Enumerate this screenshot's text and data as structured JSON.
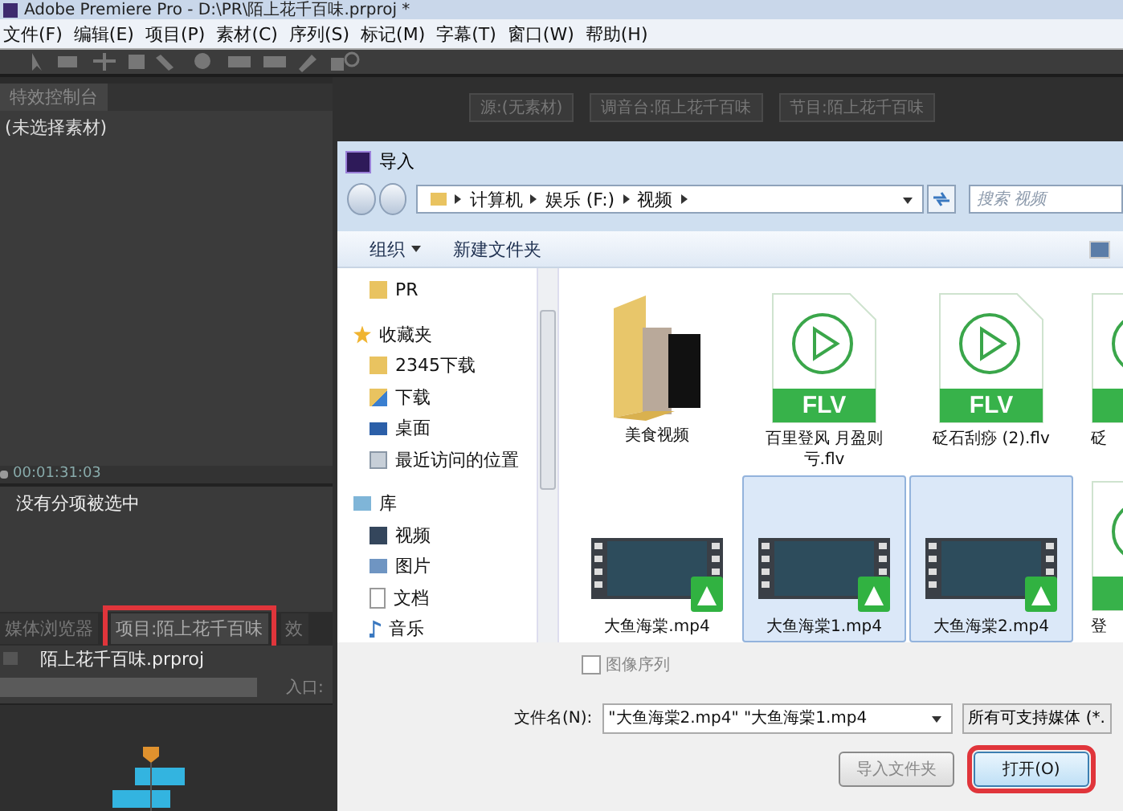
{
  "app": {
    "title": "Adobe Premiere Pro - D:\\PR\\陌上花千百味.prproj *",
    "menu": [
      "文件(F)",
      "编辑(E)",
      "项目(P)",
      "素材(C)",
      "序列(S)",
      "标记(M)",
      "字幕(T)",
      "窗口(W)",
      "帮助(H)"
    ]
  },
  "effects_panel": {
    "tab": "特效控制台",
    "message": "(未选择素材)",
    "timecode": "00:01:31:03"
  },
  "info_panel": {
    "message": "没有分项被选中"
  },
  "monitor_tabs": [
    {
      "label": "源:(无素材)"
    },
    {
      "label": "调音台:陌上花千百味"
    },
    {
      "label": "节目:陌上花千百味"
    }
  ],
  "project_tabs": [
    {
      "label": "媒体浏览器",
      "selected": false,
      "highlighted": false
    },
    {
      "label": "项目:陌上花千百味",
      "selected": true,
      "highlighted": true
    },
    {
      "label": "效",
      "selected": false,
      "highlighted": false
    }
  ],
  "project": {
    "file": "陌上花千百味.prproj",
    "in_label": "入口:"
  },
  "dialog": {
    "title": "导入",
    "breadcrumbs": [
      "计算机",
      "娱乐 (F:)",
      "视频"
    ],
    "search_placeholder": "搜索 视频",
    "toolbar": {
      "organize": "组织",
      "new_folder": "新建文件夹"
    },
    "nav": [
      {
        "label": "PR",
        "kind": "folder"
      },
      {
        "label": "收藏夹",
        "kind": "star",
        "children": [
          {
            "label": "2345下载",
            "kind": "folder"
          },
          {
            "label": "下载",
            "kind": "download"
          },
          {
            "label": "桌面",
            "kind": "desktop"
          },
          {
            "label": "最近访问的位置",
            "kind": "recent"
          }
        ]
      },
      {
        "label": "库",
        "kind": "library",
        "children": [
          {
            "label": "视频",
            "kind": "video"
          },
          {
            "label": "图片",
            "kind": "picture"
          },
          {
            "label": "文档",
            "kind": "document"
          },
          {
            "label": "音乐",
            "kind": "music"
          }
        ]
      }
    ],
    "files": [
      {
        "name": "美食视频",
        "kind": "folder",
        "selected": false
      },
      {
        "name": "百里登风 月盈则亏.flv",
        "kind": "flv",
        "badge": "FLV",
        "selected": false
      },
      {
        "name": "砭石刮痧 (2).flv",
        "kind": "flv",
        "badge": "FLV",
        "selected": false
      },
      {
        "name": "砭",
        "kind": "flv",
        "selected": false
      },
      {
        "name": "大鱼海棠.mp4",
        "kind": "mp4",
        "selected": false
      },
      {
        "name": "大鱼海棠1.mp4",
        "kind": "mp4",
        "selected": true
      },
      {
        "name": "大鱼海棠2.mp4",
        "kind": "mp4",
        "selected": true
      },
      {
        "name": "登",
        "kind": "flv",
        "selected": false
      }
    ],
    "image_sequence": {
      "label": "图像序列",
      "checked": false
    },
    "filename": {
      "label": "文件名(N):",
      "value": "\"大鱼海棠2.mp4\" \"大鱼海棠1.mp4"
    },
    "filter": "所有可支持媒体 (*.",
    "buttons": [
      {
        "label": "导入文件夹",
        "highlighted": false
      },
      {
        "label": "打开(O)",
        "highlighted": true
      }
    ]
  }
}
